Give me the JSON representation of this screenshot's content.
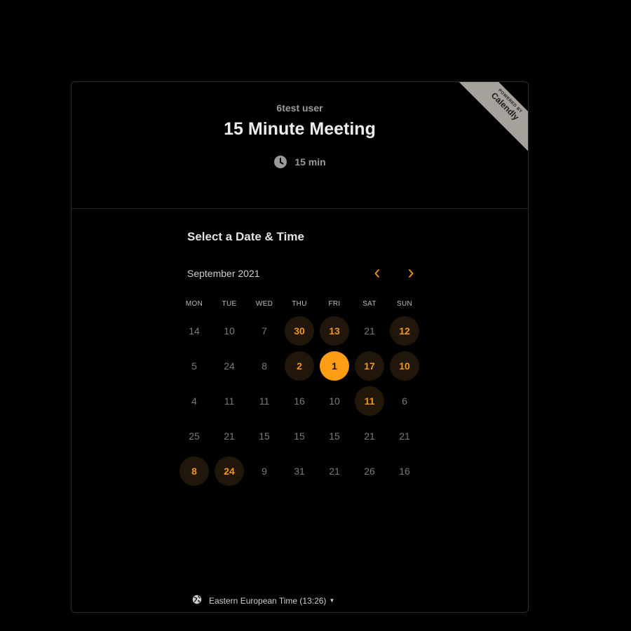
{
  "header": {
    "owner": "6test user",
    "title": "15 Minute Meeting",
    "duration": "15 min",
    "duration_icon": "clock-icon"
  },
  "ribbon": {
    "powered_by": "POWERED BY",
    "brand": "Calendly"
  },
  "scheduler": {
    "section_title": "Select a Date & Time",
    "month": "September 2021",
    "prev_icon": "chevron-left-icon",
    "next_icon": "chevron-right-icon",
    "weekdays": [
      "MON",
      "TUE",
      "WED",
      "THU",
      "FRI",
      "SAT",
      "SUN"
    ],
    "weeks": [
      [
        {
          "d": "14",
          "s": "off"
        },
        {
          "d": "10",
          "s": "off"
        },
        {
          "d": "7",
          "s": "off"
        },
        {
          "d": "30",
          "s": "available"
        },
        {
          "d": "13",
          "s": "available"
        },
        {
          "d": "21",
          "s": "off"
        },
        {
          "d": "12",
          "s": "available"
        }
      ],
      [
        {
          "d": "5",
          "s": "off"
        },
        {
          "d": "24",
          "s": "off"
        },
        {
          "d": "8",
          "s": "off"
        },
        {
          "d": "2",
          "s": "available"
        },
        {
          "d": "1",
          "s": "selected"
        },
        {
          "d": "17",
          "s": "available"
        },
        {
          "d": "10",
          "s": "available"
        }
      ],
      [
        {
          "d": "4",
          "s": "off"
        },
        {
          "d": "11",
          "s": "off"
        },
        {
          "d": "11",
          "s": "off"
        },
        {
          "d": "16",
          "s": "off"
        },
        {
          "d": "10",
          "s": "off"
        },
        {
          "d": "11",
          "s": "available"
        },
        {
          "d": "6",
          "s": "off"
        }
      ],
      [
        {
          "d": "25",
          "s": "off"
        },
        {
          "d": "21",
          "s": "off"
        },
        {
          "d": "15",
          "s": "off"
        },
        {
          "d": "15",
          "s": "off"
        },
        {
          "d": "15",
          "s": "off"
        },
        {
          "d": "21",
          "s": "off"
        },
        {
          "d": "21",
          "s": "off"
        }
      ],
      [
        {
          "d": "8",
          "s": "available"
        },
        {
          "d": "24",
          "s": "available"
        },
        {
          "d": "9",
          "s": "off"
        },
        {
          "d": "31",
          "s": "off"
        },
        {
          "d": "21",
          "s": "off"
        },
        {
          "d": "26",
          "s": "off"
        },
        {
          "d": "16",
          "s": "off"
        }
      ]
    ],
    "timezone": "Eastern European Time (13:26)",
    "timezone_icon": "globe-icon"
  },
  "colors": {
    "accent": "#ff9e15",
    "available_bg": "#21160a",
    "background": "#000000",
    "ribbon": "#a7a19c"
  }
}
